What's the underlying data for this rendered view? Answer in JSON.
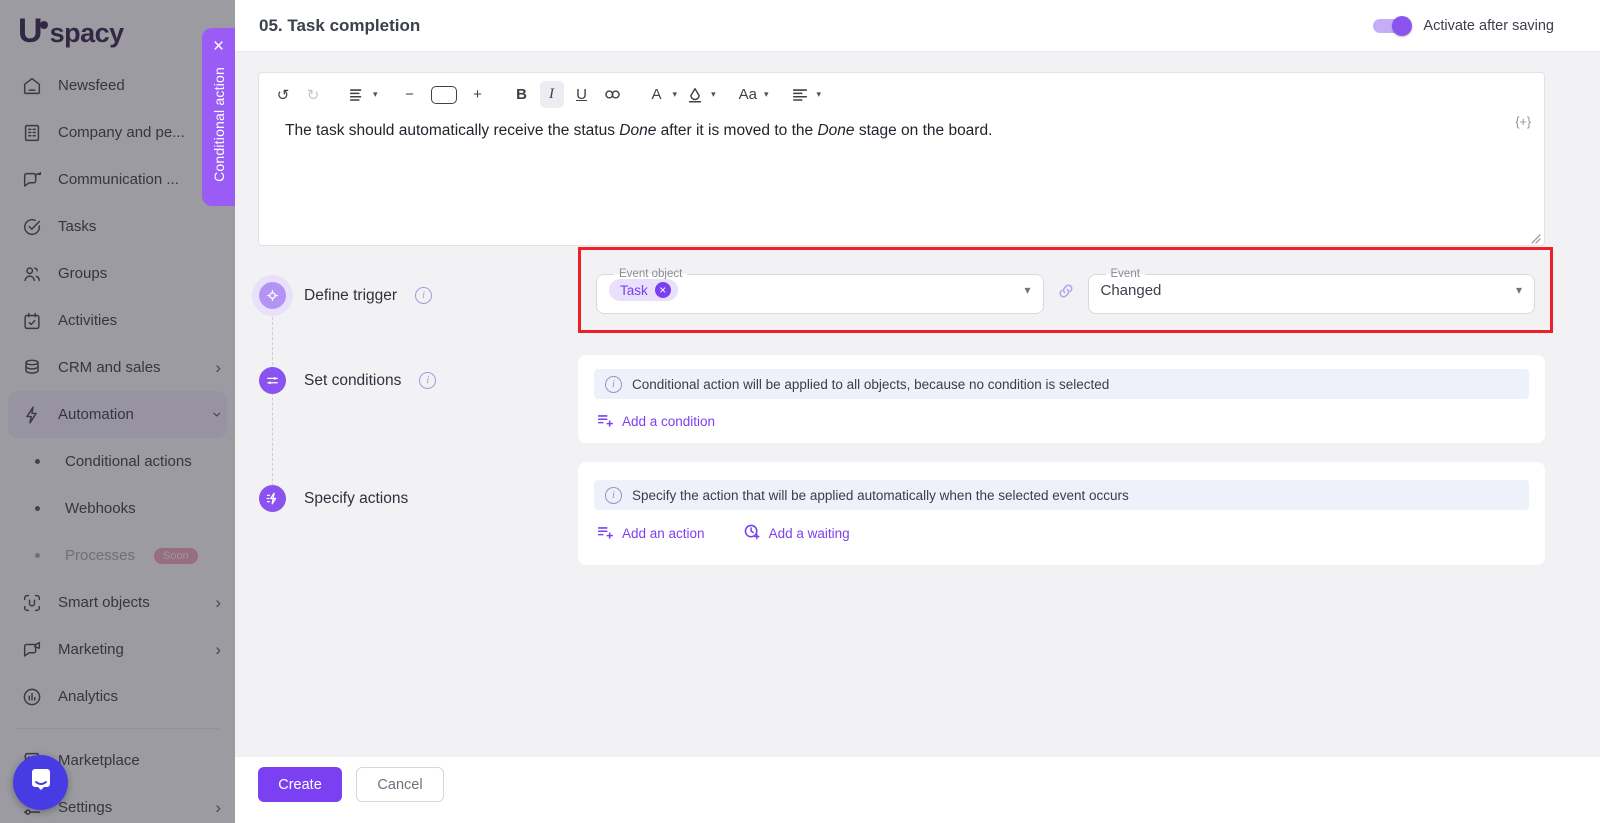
{
  "sidebar": {
    "logo_letter": "U",
    "logo_text": "spacy",
    "items": [
      {
        "label": "Newsfeed",
        "icon": "home-icon"
      },
      {
        "label": "Company and pe...",
        "icon": "company-icon",
        "chevron": "›"
      },
      {
        "label": "Communication ...",
        "icon": "communication-icon",
        "chevron": "›"
      },
      {
        "label": "Tasks",
        "icon": "tasks-icon"
      },
      {
        "label": "Groups",
        "icon": "groups-icon"
      },
      {
        "label": "Activities",
        "icon": "activities-icon"
      },
      {
        "label": "CRM and sales",
        "icon": "crm-icon",
        "chevron": "›"
      },
      {
        "label": "Automation",
        "icon": "automation-icon",
        "chevron": "⌄",
        "state": "expanded-active"
      },
      {
        "label": "Conditional actions",
        "sub": true
      },
      {
        "label": "Webhooks",
        "sub": true
      },
      {
        "label": "Processes",
        "sub": true,
        "badge": "Soon",
        "state": "disabled"
      },
      {
        "label": "Smart objects",
        "icon": "smart-objects-icon",
        "chevron": "›"
      },
      {
        "label": "Marketing",
        "icon": "marketing-icon",
        "chevron": "›"
      },
      {
        "label": "Analytics",
        "icon": "analytics-icon"
      },
      {
        "label": "Marketplace",
        "icon": "marketplace-icon"
      },
      {
        "label": "Settings",
        "icon": "settings-icon",
        "chevron": "›"
      }
    ]
  },
  "slideover": {
    "tab_label": "Conditional action",
    "close_glyph": "×"
  },
  "header": {
    "title": "05. Task completion",
    "toggle_label": "Activate after saving",
    "toggle_state": "on"
  },
  "editor": {
    "toolbar": {
      "undo": "↺",
      "redo": "↻",
      "minus": "−",
      "plus": "+",
      "bold": "B",
      "italic": "I",
      "underline": "U",
      "text_color": "A",
      "text_case": "Aa",
      "dropdown": "▾"
    },
    "italic_active": true,
    "text_parts": [
      "The task should automatically receive the status ",
      "Done",
      " after it is moved to the ",
      "Done",
      " stage on the board."
    ],
    "insert_token": "{+}"
  },
  "trigger": {
    "step_label": "Define trigger",
    "event_object": {
      "label": "Event object",
      "chip": "Task",
      "chip_remove_glyph": "×",
      "dropdown": "▾"
    },
    "event": {
      "label": "Event",
      "value": "Changed",
      "dropdown": "▾"
    }
  },
  "conditions": {
    "step_label": "Set conditions",
    "banner": "Conditional action will be applied to all objects, because no condition is selected",
    "add_condition": "Add a condition"
  },
  "actions": {
    "step_label": "Specify actions",
    "banner": "Specify the action that will be applied automatically when the selected event occurs",
    "add_action": "Add an action",
    "add_waiting": "Add a waiting"
  },
  "footer": {
    "create": "Create",
    "cancel": "Cancel"
  },
  "colors": {
    "accent_purple": "#7b40f2",
    "tab_purple": "#9a5cf5",
    "highlight_red": "#ec2027",
    "chip_bg": "#e9e0fc",
    "banner_bg": "#eef0fa",
    "toggle_on": "#8a53f0",
    "soon_badge_bg": "#f0a9bc",
    "chat_widget_bg": "#473be4"
  }
}
